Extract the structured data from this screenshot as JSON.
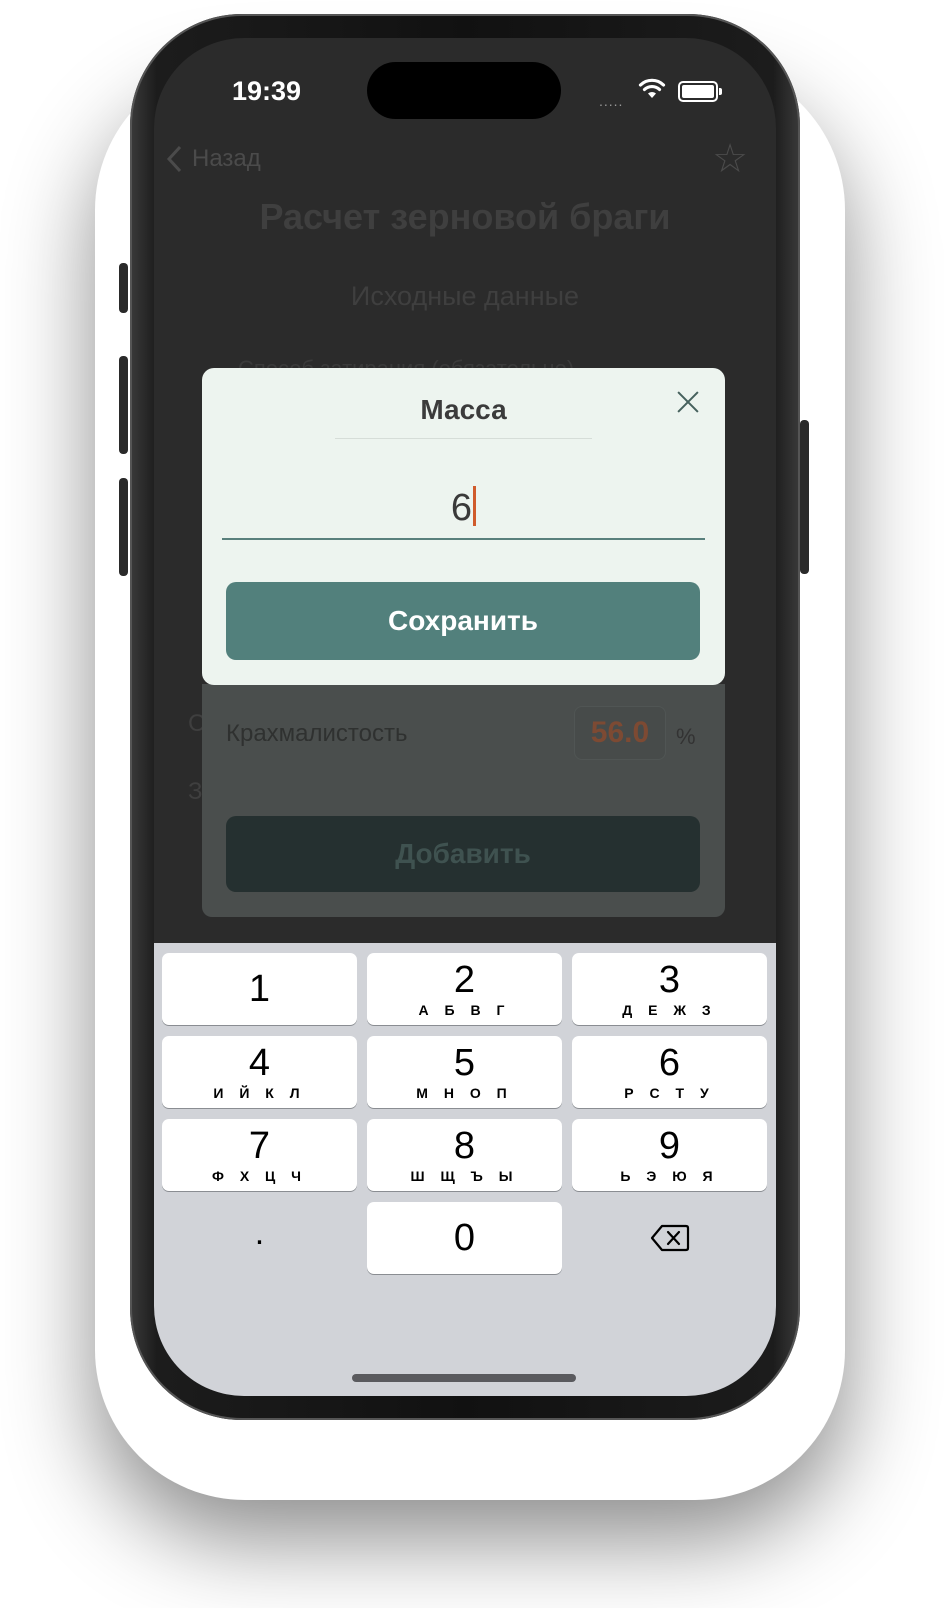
{
  "status_bar": {
    "time": "19:39",
    "dots": "....."
  },
  "background": {
    "back_label": "Назад",
    "star": "☆",
    "title": "Расчет зерновой браги",
    "subtitle": "Исходные данные",
    "hidden_row": "Способ затирания (обязательно)",
    "partial_left_1": "С",
    "partial_left_2": "З"
  },
  "dialog": {
    "title": "Масса",
    "input_value": "6",
    "save_label": "Сохранить"
  },
  "sheet": {
    "starch_label": "Крахмалистость",
    "starch_value": "56.0",
    "starch_unit": "%",
    "add_label": "Добавить"
  },
  "keyboard": {
    "keys": [
      {
        "num": "1",
        "letters": ""
      },
      {
        "num": "2",
        "letters": "А Б В Г"
      },
      {
        "num": "3",
        "letters": "Д Е Ж З"
      },
      {
        "num": "4",
        "letters": "И Й К Л"
      },
      {
        "num": "5",
        "letters": "М Н О П"
      },
      {
        "num": "6",
        "letters": "Р С Т У"
      },
      {
        "num": "7",
        "letters": "Ф Х Ц Ч"
      },
      {
        "num": "8",
        "letters": "Ш Щ Ъ Ы"
      },
      {
        "num": "9",
        "letters": "Ь Э Ю Я"
      }
    ],
    "dot": ".",
    "zero": "0"
  }
}
